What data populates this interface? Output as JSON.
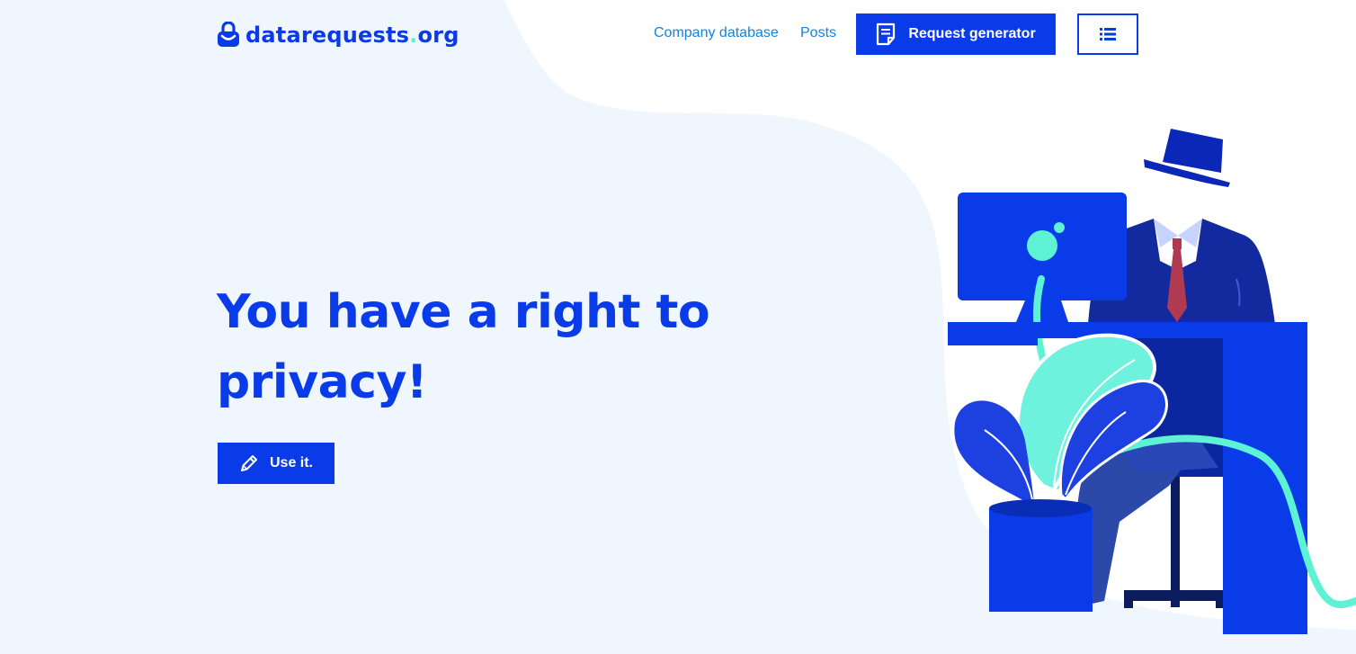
{
  "colors": {
    "page_background": "#eff6fd",
    "white_wave": "#ffffff",
    "brand_blue": "#0a3be8",
    "link_blue": "#1582dc",
    "accent_teal": "#5cf2d3",
    "navy": "#0c2aa8",
    "tie_red": "#b03a52"
  },
  "header": {
    "logo": {
      "icon": "lock-bag-icon",
      "name": "datarequests",
      "dot": ".",
      "tld": "org"
    },
    "nav": {
      "company_database": "Company database",
      "posts": "Posts"
    },
    "request_generator": {
      "label": "Request generator",
      "icon": "document-icon"
    },
    "menu_button": {
      "icon": "list-icon"
    }
  },
  "hero": {
    "title": "You have a right to privacy!",
    "cta": {
      "label": "Use it.",
      "icon": "pencil-icon"
    }
  },
  "illustration": {
    "subject": "invisible-man-at-desk-illustration"
  }
}
